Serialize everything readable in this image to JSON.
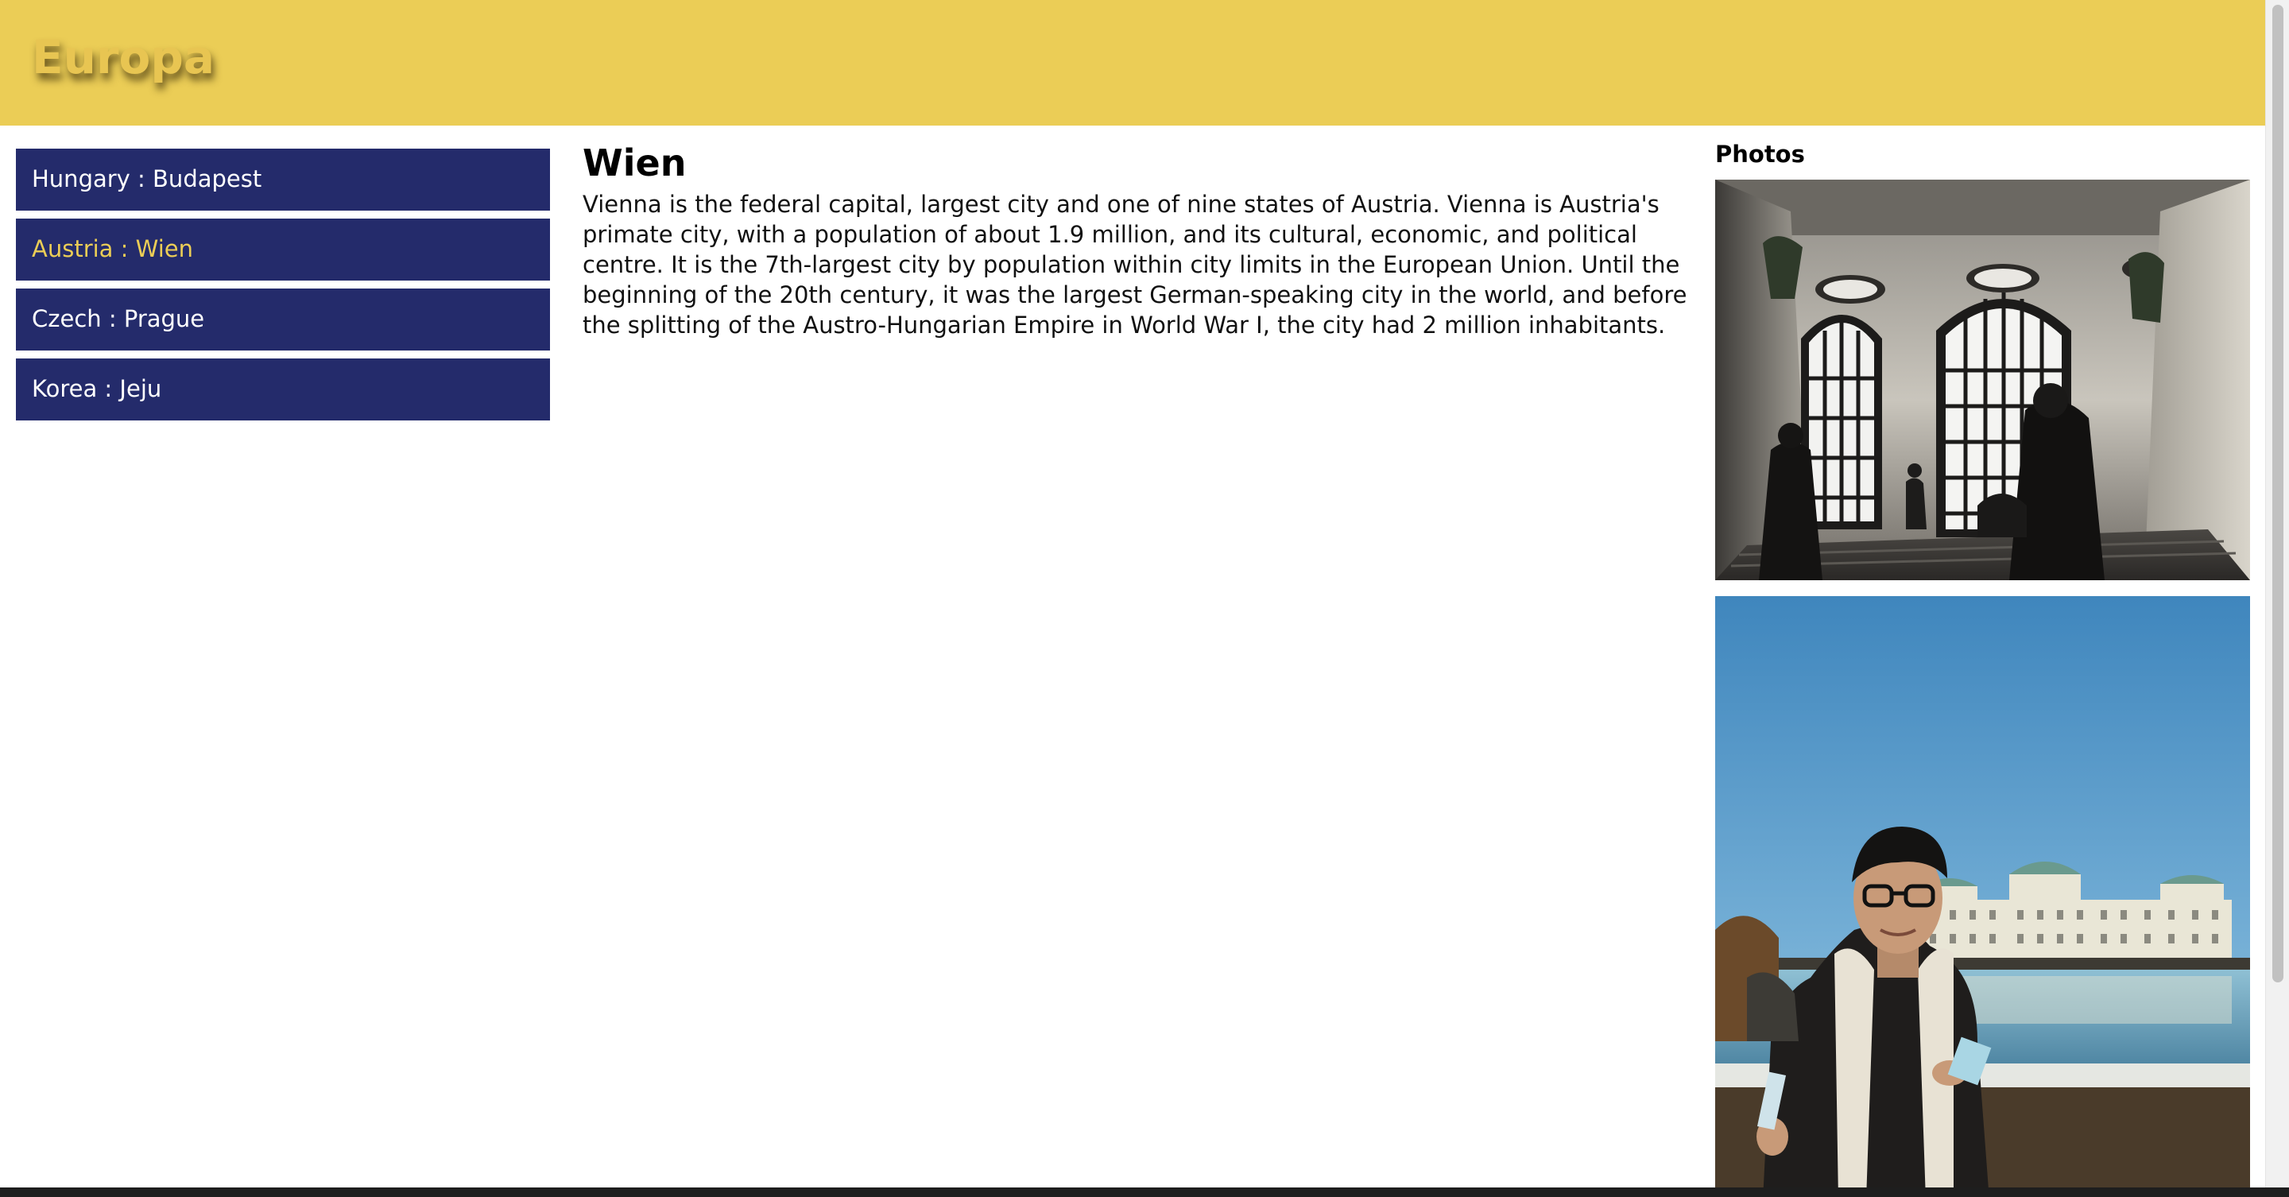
{
  "header": {
    "title": "Europa",
    "background_color": "#ebcd56"
  },
  "sidebar": {
    "items": [
      {
        "label": "Hungary : Budapest",
        "active": false
      },
      {
        "label": "Austria : Wien",
        "active": true
      },
      {
        "label": "Czech : Prague",
        "active": false
      },
      {
        "label": "Korea : Jeju",
        "active": false
      }
    ],
    "item_color": "#242b6b",
    "active_text_color": "#ebcd56"
  },
  "main": {
    "title": "Wien",
    "body": "Vienna is the federal capital, largest city and one of nine states of Austria. Vienna is Austria's primate city, with a population of about 1.9 million, and its cultural, economic, and political centre. It is the 7th-largest city by population within city limits in the European Union. Until the beginning of the 20th century, it was the largest German-speaking city in the world, and before the splitting of the Austro-Hungarian Empire in World War I, the city had 2 million inhabitants."
  },
  "photos": {
    "heading": "Photos",
    "items": [
      {
        "subject": "palace-staircase-interior-photo"
      },
      {
        "subject": "portrait-in-front-of-palace-photo"
      }
    ]
  }
}
